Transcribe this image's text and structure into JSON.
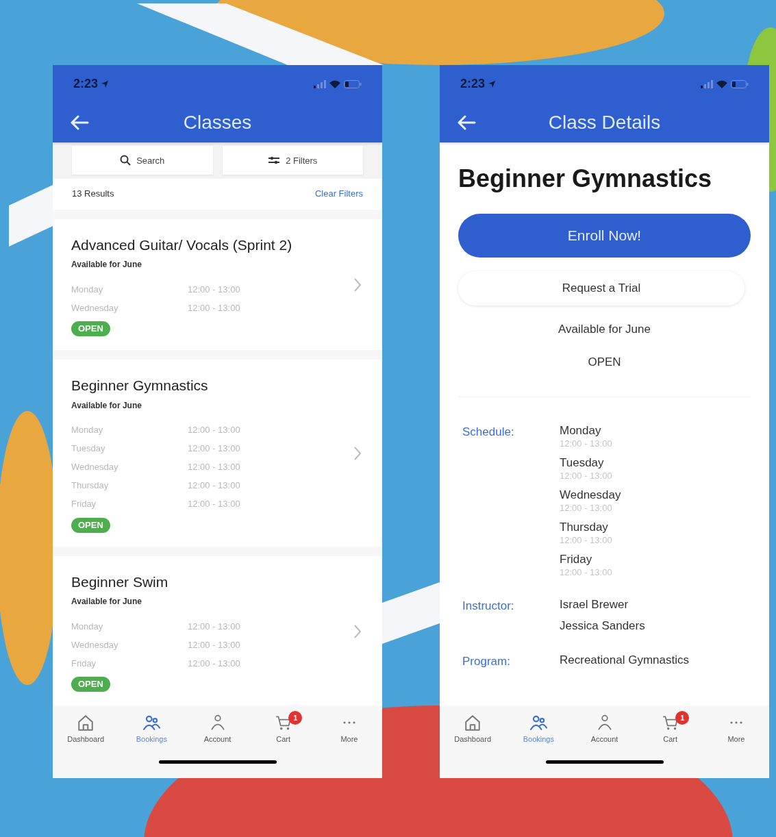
{
  "screens": [
    {
      "kind": "list",
      "status_bar": {
        "time": "2:23"
      },
      "header": {
        "title": "Classes"
      },
      "search": {
        "label": "Search"
      },
      "filters": {
        "label": "2 Filters"
      },
      "results": "13 Results",
      "clear_filters": "Clear Filters",
      "classes": [
        {
          "title": "Advanced Guitar/ Vocals (Sprint 2)",
          "availability": "Available for June",
          "schedule": [
            {
              "day": "Monday",
              "time": "12:00 - 13:00"
            },
            {
              "day": "Wednesday",
              "time": "12:00 - 13:00"
            }
          ],
          "status": "OPEN"
        },
        {
          "title": "Beginner Gymnastics",
          "availability": "Available for June",
          "schedule": [
            {
              "day": "Monday",
              "time": "12:00 - 13:00"
            },
            {
              "day": "Tuesday",
              "time": "12:00 - 13:00"
            },
            {
              "day": "Wednesday",
              "time": "12:00 - 13:00"
            },
            {
              "day": "Thursday",
              "time": "12:00 - 13:00"
            },
            {
              "day": "Friday",
              "time": "12:00 - 13:00"
            }
          ],
          "status": "OPEN"
        },
        {
          "title": "Beginner Swim",
          "availability": "Available for June",
          "schedule": [
            {
              "day": "Monday",
              "time": "12:00 - 13:00"
            },
            {
              "day": "Wednesday",
              "time": "12:00 - 13:00"
            },
            {
              "day": "Friday",
              "time": "12:00 - 13:00"
            }
          ],
          "status": "OPEN"
        }
      ],
      "tab_bar": [
        {
          "label": "Dashboard",
          "selected": false
        },
        {
          "label": "Bookings",
          "selected": true
        },
        {
          "label": "Account",
          "selected": false
        },
        {
          "label": "Cart",
          "selected": false,
          "badge": "1"
        },
        {
          "label": "More",
          "selected": false
        }
      ]
    },
    {
      "kind": "detail",
      "status_bar": {
        "time": "2:23"
      },
      "header": {
        "title": "Class Details"
      },
      "class_title": "Beginner Gymnastics",
      "enroll_button": "Enroll Now!",
      "trial_button": "Request a Trial",
      "availability": "Available for June",
      "status": "OPEN",
      "details": [
        {
          "label": "Schedule:",
          "entries": [
            {
              "text": "Monday",
              "sub": "12:00 - 13:00"
            },
            {
              "text": "Tuesday",
              "sub": "12:00 - 13:00"
            },
            {
              "text": "Wednesday",
              "sub": "12:00 - 13:00"
            },
            {
              "text": "Thursday",
              "sub": "12:00 - 13:00"
            },
            {
              "text": "Friday",
              "sub": "12:00 - 13:00"
            }
          ]
        },
        {
          "label": "Instructor:",
          "entries": [
            {
              "text": "Israel Brewer"
            },
            {
              "text": "Jessica Sanders"
            }
          ]
        },
        {
          "label": "Program:",
          "entries": [
            {
              "text": "Recreational Gymnastics"
            }
          ]
        }
      ],
      "tab_bar": [
        {
          "label": "Dashboard",
          "selected": false
        },
        {
          "label": "Bookings",
          "selected": true
        },
        {
          "label": "Account",
          "selected": false
        },
        {
          "label": "Cart",
          "selected": false,
          "badge": "1"
        },
        {
          "label": "More",
          "selected": false
        }
      ]
    }
  ]
}
